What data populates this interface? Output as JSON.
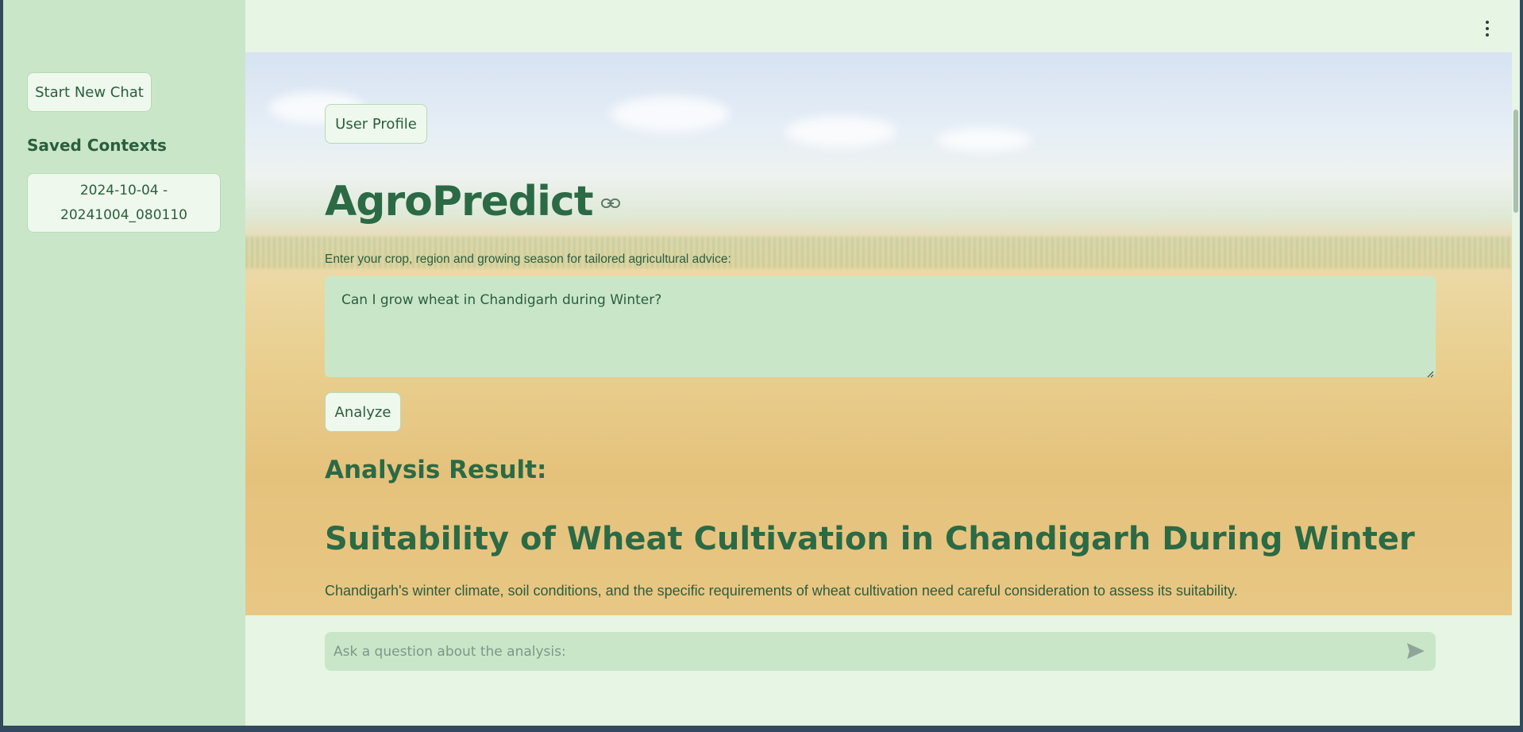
{
  "sidebar": {
    "new_chat_label": "Start New Chat",
    "saved_contexts_title": "Saved Contexts",
    "saved_contexts": [
      {
        "line1": "2024-10-04 -",
        "line2": "20241004_080110"
      }
    ]
  },
  "header": {
    "menu_icon": "kebab-menu-icon"
  },
  "main": {
    "user_profile_label": "User Profile",
    "title": "AgroPredict",
    "title_link_icon": "link-icon",
    "input_label": "Enter your crop, region and growing season for tailored agricultural advice:",
    "query_value": "Can I grow wheat in Chandigarh during Winter?",
    "analyze_label": "Analyze",
    "result_heading": "Analysis Result:",
    "result_title": "Suitability of Wheat Cultivation in Chandigarh During Winter",
    "result_paragraph": "Chandigarh's winter climate, soil conditions, and the specific requirements of wheat cultivation need careful consideration to assess its suitability."
  },
  "chat": {
    "placeholder": "Ask a question about the analysis:",
    "send_icon": "send-icon"
  },
  "colors": {
    "accent": "#2b6a45",
    "sidebar_bg": "#c9e7c8",
    "page_bg": "#e6f5e4",
    "input_bg": "#c9e7c8"
  }
}
